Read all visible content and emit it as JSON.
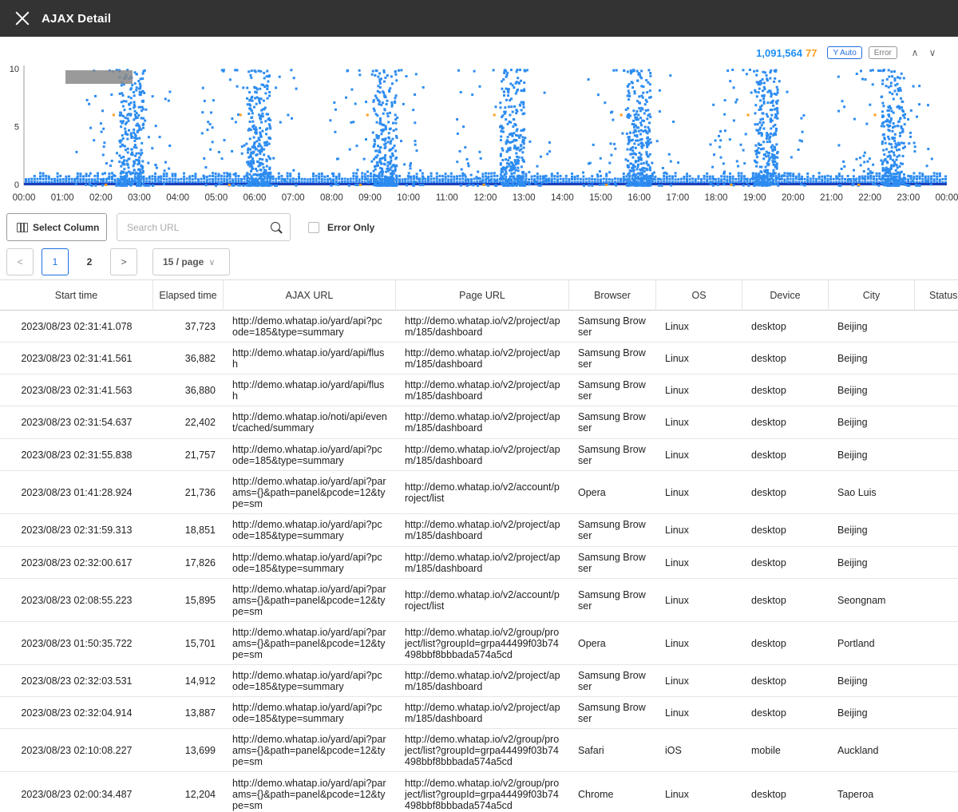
{
  "window": {
    "title": "AJAX  Detail"
  },
  "chart_header": {
    "total_count": "1,091,564",
    "error_count": "77",
    "y_auto_label": "Y Auto",
    "error_label": "Error"
  },
  "chart_data": {
    "type": "scatter",
    "title": "",
    "xlabel": "",
    "ylabel": "",
    "ylim": [
      0,
      10
    ],
    "y_ticks": [
      "10",
      "5",
      "0"
    ],
    "x_ticks": [
      "00:00",
      "01:00",
      "02:00",
      "03:00",
      "04:00",
      "05:00",
      "06:00",
      "07:00",
      "08:00",
      "09:00",
      "10:00",
      "11:00",
      "12:00",
      "13:00",
      "14:00",
      "15:00",
      "16:00",
      "17:00",
      "18:00",
      "19:00",
      "20:00",
      "21:00",
      "22:00",
      "23:00",
      "00:00"
    ],
    "series": [
      {
        "color": "#2d8cf0",
        "description_peaks_hours": [
          2.8,
          6.1,
          9.4,
          12.7,
          16.0,
          19.3,
          22.6
        ]
      },
      {
        "color": "#ff9d1c"
      }
    ],
    "legend": "none",
    "grid": false
  },
  "toolbar": {
    "select_column_label": "Select Column",
    "search_placeholder": "Search URL",
    "error_only_label": "Error Only"
  },
  "pagination": {
    "pages": [
      "1",
      "2"
    ],
    "active_page": "1",
    "per_page_label": "15 / page",
    "prev": "<",
    "next": ">"
  },
  "table": {
    "columns": [
      "Start time",
      "Elapsed time",
      "AJAX URL",
      "Page URL",
      "Browser",
      "OS",
      "Device",
      "City",
      "Status"
    ],
    "rows": [
      {
        "start": "2023/08/23 02:31:41.078",
        "elapsed": "37,723",
        "ajax": "http://demo.whatap.io/yard/api?pcode=185&type=summary",
        "page": "http://demo.whatap.io/v2/project/apm/185/dashboard",
        "browser": "Samsung Browser",
        "os": "Linux",
        "device": "desktop",
        "city": "Beijing"
      },
      {
        "start": "2023/08/23 02:31:41.561",
        "elapsed": "36,882",
        "ajax": "http://demo.whatap.io/yard/api/flush",
        "page": "http://demo.whatap.io/v2/project/apm/185/dashboard",
        "browser": "Samsung Browser",
        "os": "Linux",
        "device": "desktop",
        "city": "Beijing"
      },
      {
        "start": "2023/08/23 02:31:41.563",
        "elapsed": "36,880",
        "ajax": "http://demo.whatap.io/yard/api/flush",
        "page": "http://demo.whatap.io/v2/project/apm/185/dashboard",
        "browser": "Samsung Browser",
        "os": "Linux",
        "device": "desktop",
        "city": "Beijing"
      },
      {
        "start": "2023/08/23 02:31:54.637",
        "elapsed": "22,402",
        "ajax": "http://demo.whatap.io/noti/api/event/cached/summary",
        "page": "http://demo.whatap.io/v2/project/apm/185/dashboard",
        "browser": "Samsung Browser",
        "os": "Linux",
        "device": "desktop",
        "city": "Beijing"
      },
      {
        "start": "2023/08/23 02:31:55.838",
        "elapsed": "21,757",
        "ajax": "http://demo.whatap.io/yard/api?pcode=185&type=summary",
        "page": "http://demo.whatap.io/v2/project/apm/185/dashboard",
        "browser": "Samsung Browser",
        "os": "Linux",
        "device": "desktop",
        "city": "Beijing"
      },
      {
        "start": "2023/08/23 01:41:28.924",
        "elapsed": "21,736",
        "ajax": "http://demo.whatap.io/yard/api?params={}&path=panel&pcode=12&type=sm",
        "page": "http://demo.whatap.io/v2/account/project/list",
        "browser": "Opera",
        "os": "Linux",
        "device": "desktop",
        "city": "Sao Luis"
      },
      {
        "start": "2023/08/23 02:31:59.313",
        "elapsed": "18,851",
        "ajax": "http://demo.whatap.io/yard/api?pcode=185&type=summary",
        "page": "http://demo.whatap.io/v2/project/apm/185/dashboard",
        "browser": "Samsung Browser",
        "os": "Linux",
        "device": "desktop",
        "city": "Beijing"
      },
      {
        "start": "2023/08/23 02:32:00.617",
        "elapsed": "17,826",
        "ajax": "http://demo.whatap.io/yard/api?pcode=185&type=summary",
        "page": "http://demo.whatap.io/v2/project/apm/185/dashboard",
        "browser": "Samsung Browser",
        "os": "Linux",
        "device": "desktop",
        "city": "Beijing"
      },
      {
        "start": "2023/08/23 02:08:55.223",
        "elapsed": "15,895",
        "ajax": "http://demo.whatap.io/yard/api?params={}&path=panel&pcode=12&type=sm",
        "page": "http://demo.whatap.io/v2/account/project/list",
        "browser": "Samsung Browser",
        "os": "Linux",
        "device": "desktop",
        "city": "Seongnam"
      },
      {
        "start": "2023/08/23 01:50:35.722",
        "elapsed": "15,701",
        "ajax": "http://demo.whatap.io/yard/api?params={}&path=panel&pcode=12&type=sm",
        "page": "http://demo.whatap.io/v2/group/project/list?groupId=grpa44499f03b74498bbf8bbbada574a5cd",
        "browser": "Opera",
        "os": "Linux",
        "device": "desktop",
        "city": "Portland"
      },
      {
        "start": "2023/08/23 02:32:03.531",
        "elapsed": "14,912",
        "ajax": "http://demo.whatap.io/yard/api?pcode=185&type=summary",
        "page": "http://demo.whatap.io/v2/project/apm/185/dashboard",
        "browser": "Samsung Browser",
        "os": "Linux",
        "device": "desktop",
        "city": "Beijing"
      },
      {
        "start": "2023/08/23 02:32:04.914",
        "elapsed": "13,887",
        "ajax": "http://demo.whatap.io/yard/api?pcode=185&type=summary",
        "page": "http://demo.whatap.io/v2/project/apm/185/dashboard",
        "browser": "Samsung Browser",
        "os": "Linux",
        "device": "desktop",
        "city": "Beijing"
      },
      {
        "start": "2023/08/23 02:10:08.227",
        "elapsed": "13,699",
        "ajax": "http://demo.whatap.io/yard/api?params={}&path=panel&pcode=12&type=sm",
        "page": "http://demo.whatap.io/v2/group/project/list?groupId=grpa44499f03b74498bbf8bbbada574a5cd",
        "browser": "Safari",
        "os": "iOS",
        "device": "mobile",
        "city": "Auckland"
      },
      {
        "start": "2023/08/23 02:00:34.487",
        "elapsed": "12,204",
        "ajax": "http://demo.whatap.io/yard/api?params={}&path=panel&pcode=12&type=sm",
        "page": "http://demo.whatap.io/v2/group/project/list?groupId=grpa44499f03b74498bbf8bbbada574a5cd",
        "browser": "Chrome",
        "os": "Linux",
        "device": "desktop",
        "city": "Taperoa"
      }
    ]
  }
}
